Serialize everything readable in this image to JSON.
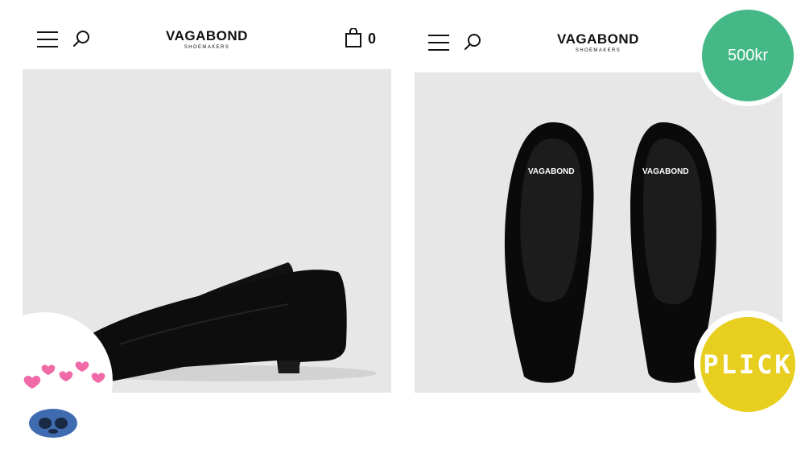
{
  "left_panel": {
    "logo": {
      "brand": "VAGABOND",
      "sub": "SHOEMAKERS"
    },
    "cart_count": "0",
    "icons": {
      "menu": "hamburger-menu-icon",
      "search": "search-icon",
      "cart": "shopping-bag-icon"
    }
  },
  "right_panel": {
    "logo": {
      "brand": "VAGABOND",
      "sub": "SHOEMAKERS"
    },
    "insole_logo": "VAGABOND",
    "icons": {
      "menu": "hamburger-menu-icon",
      "search": "search-icon"
    }
  },
  "badges": {
    "price": "500kr",
    "plick": "PLICK"
  },
  "colors": {
    "price_badge": "#45b887",
    "plick_badge": "#e8cf1f",
    "photo_bg": "#e7e7e7",
    "shoe": "#0d0d0d",
    "hearts": "#f06aa8"
  }
}
